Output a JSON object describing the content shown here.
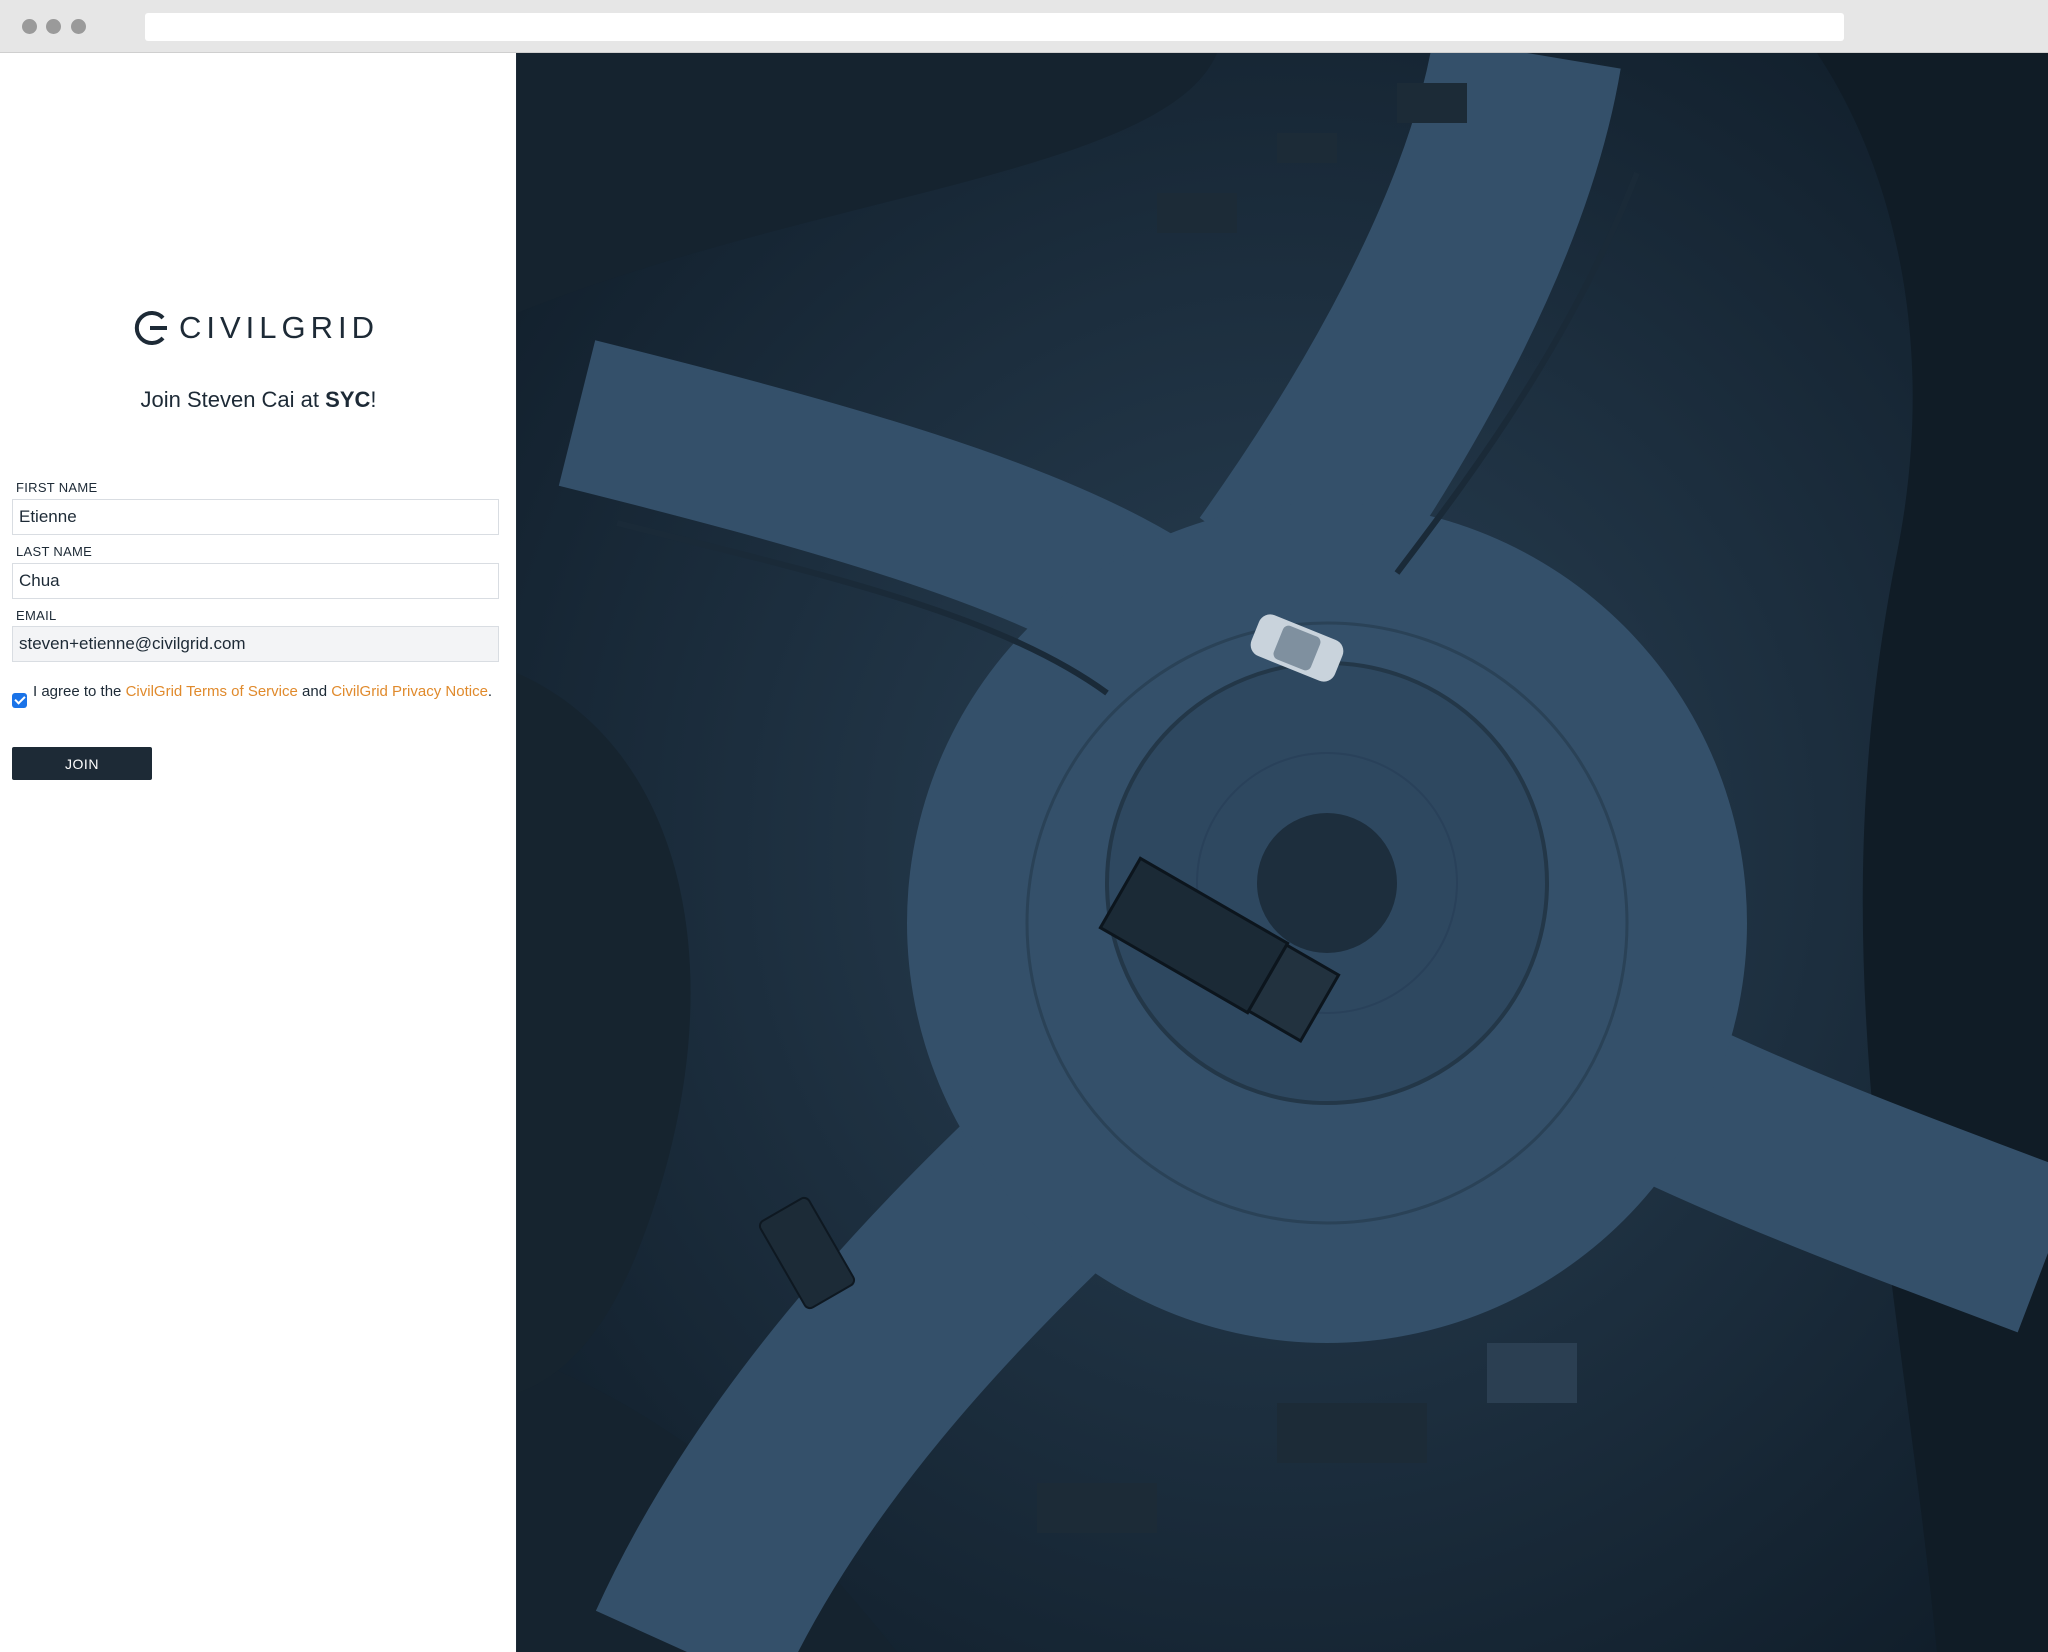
{
  "brand": {
    "name": "CIVILGRID",
    "primary_color": "#1d2a36",
    "link_color": "#e08a2c",
    "checkbox_color": "#1a73e8",
    "background_photo_tint": "#1a2c3d"
  },
  "headline": {
    "prefix": "Join Steven Cai at ",
    "org": "SYC",
    "suffix": "!"
  },
  "form": {
    "first_name": {
      "label": "FIRST NAME",
      "value": "Etienne"
    },
    "last_name": {
      "label": "LAST NAME",
      "value": "Chua"
    },
    "email": {
      "label": "EMAIL",
      "value": "steven+etienne@civilgrid.com"
    },
    "agree": {
      "checked": true,
      "text_1": "I agree to the ",
      "terms_link": "CivilGrid Terms of Service",
      "text_2": " and ",
      "privacy_link": "CivilGrid Privacy Notice",
      "text_3": "."
    },
    "join_label": "JOIN"
  },
  "background_image": {
    "icon": "aerial-roundabout-photo"
  }
}
